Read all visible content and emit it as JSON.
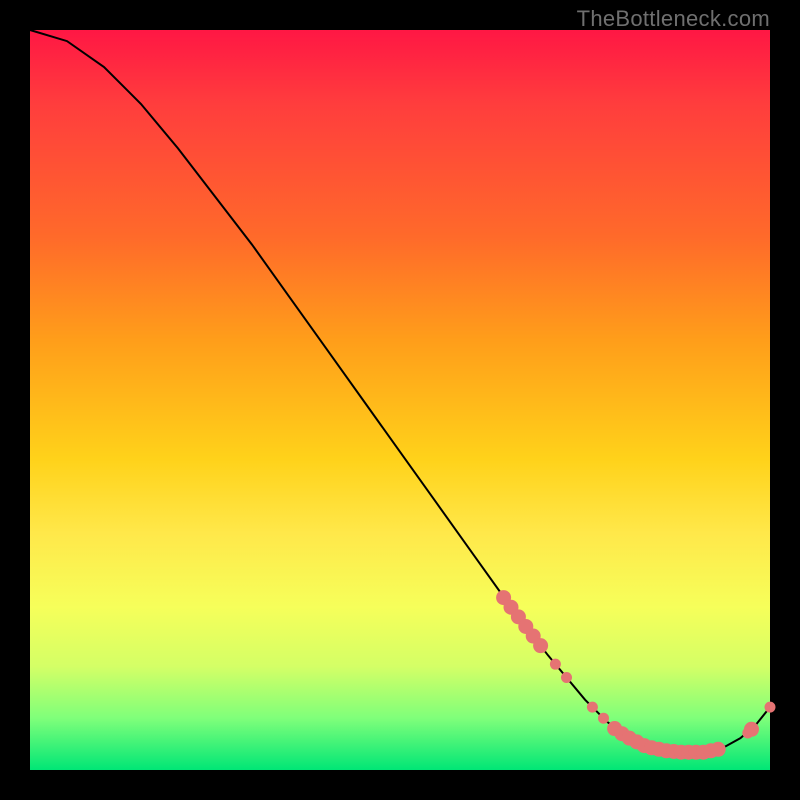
{
  "watermark": "TheBottleneck.com",
  "chart_data": {
    "type": "line",
    "title": "",
    "xlabel": "",
    "ylabel": "",
    "xlim": [
      0,
      100
    ],
    "ylim": [
      0,
      100
    ],
    "grid": false,
    "legend": false,
    "series": [
      {
        "name": "curve",
        "color": "#000000",
        "x": [
          0,
          5,
          10,
          15,
          20,
          25,
          30,
          35,
          40,
          45,
          50,
          55,
          60,
          65,
          70,
          75,
          78,
          80,
          82,
          84,
          86,
          88,
          90,
          92,
          94,
          96,
          98,
          100
        ],
        "y": [
          100,
          98.5,
          95,
          90,
          84,
          77.5,
          71,
          64,
          57,
          50,
          43,
          36,
          29,
          22,
          15.5,
          9.5,
          6.5,
          5,
          3.8,
          3,
          2.6,
          2.4,
          2.4,
          2.6,
          3.2,
          4.3,
          6,
          8.5
        ]
      },
      {
        "name": "markers",
        "color": "#e57373",
        "marker_radius": 5.5,
        "big_marker_radius": 7.5,
        "points": [
          {
            "x": 64,
            "y": 23.3,
            "big": true
          },
          {
            "x": 65,
            "y": 22.0,
            "big": true
          },
          {
            "x": 66,
            "y": 20.7,
            "big": true
          },
          {
            "x": 67,
            "y": 19.4,
            "big": true
          },
          {
            "x": 68,
            "y": 18.1,
            "big": true
          },
          {
            "x": 69,
            "y": 16.8,
            "big": true
          },
          {
            "x": 71,
            "y": 14.3,
            "big": false
          },
          {
            "x": 72.5,
            "y": 12.5,
            "big": false
          },
          {
            "x": 76,
            "y": 8.5,
            "big": false
          },
          {
            "x": 77.5,
            "y": 7.0,
            "big": false
          },
          {
            "x": 79,
            "y": 5.6,
            "big": true
          },
          {
            "x": 80,
            "y": 4.9,
            "big": true
          },
          {
            "x": 81,
            "y": 4.3,
            "big": true
          },
          {
            "x": 82,
            "y": 3.8,
            "big": true
          },
          {
            "x": 83,
            "y": 3.3,
            "big": true
          },
          {
            "x": 84,
            "y": 3.0,
            "big": true
          },
          {
            "x": 85,
            "y": 2.8,
            "big": true
          },
          {
            "x": 86,
            "y": 2.6,
            "big": true
          },
          {
            "x": 87,
            "y": 2.5,
            "big": true
          },
          {
            "x": 88,
            "y": 2.4,
            "big": true
          },
          {
            "x": 89,
            "y": 2.4,
            "big": true
          },
          {
            "x": 90,
            "y": 2.4,
            "big": true
          },
          {
            "x": 91,
            "y": 2.4,
            "big": true
          },
          {
            "x": 92,
            "y": 2.6,
            "big": true
          },
          {
            "x": 93,
            "y": 2.8,
            "big": true
          },
          {
            "x": 97,
            "y": 5.0,
            "big": false
          },
          {
            "x": 97.5,
            "y": 5.5,
            "big": true
          },
          {
            "x": 100,
            "y": 8.5,
            "big": false
          }
        ]
      }
    ]
  }
}
